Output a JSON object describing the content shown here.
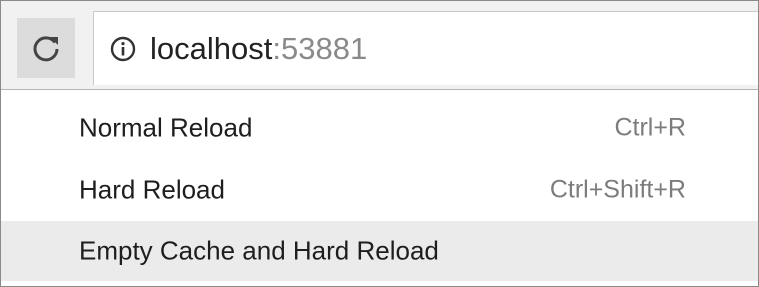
{
  "toolbar": {
    "reload_icon": "reload-icon",
    "info_icon": "info-icon"
  },
  "address_bar": {
    "host": "localhost",
    "separator": ":",
    "port": "53881"
  },
  "context_menu": {
    "items": [
      {
        "label": "Normal Reload",
        "shortcut": "Ctrl+R",
        "highlighted": false
      },
      {
        "label": "Hard Reload",
        "shortcut": "Ctrl+Shift+R",
        "highlighted": false
      },
      {
        "label": "Empty Cache and Hard Reload",
        "shortcut": "",
        "highlighted": true
      }
    ]
  },
  "colors": {
    "toolbar_bg": "#f1f1f1",
    "reload_button_bg": "#dcdcdc",
    "highlight_bg": "#ebebeb",
    "text": "#1e1e1e",
    "muted_text": "#7c7c7c"
  }
}
